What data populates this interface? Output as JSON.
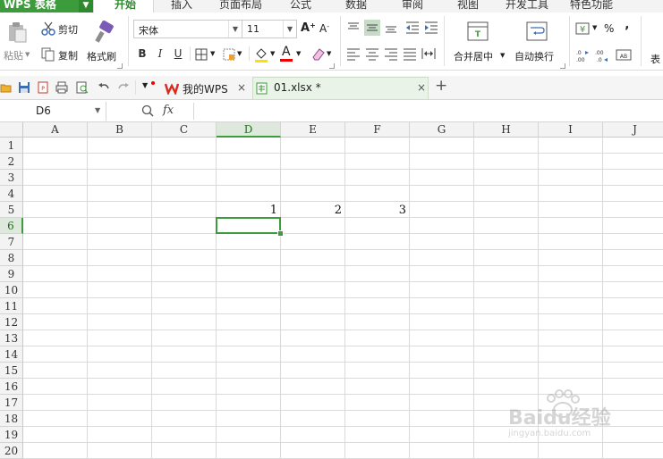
{
  "app": {
    "title": "WPS 表格"
  },
  "menu": [
    "开始",
    "插入",
    "页面布局",
    "公式",
    "数据",
    "审阅",
    "视图",
    "开发工具",
    "特色功能"
  ],
  "ribbon": {
    "paste": "粘贴",
    "cut": "剪切",
    "copy": "复制",
    "format_painter": "格式刷",
    "font_name": "宋体",
    "font_size": "11",
    "bold": "B",
    "italic": "I",
    "underline": "U",
    "merge_center": "合并居中",
    "wrap_text": "自动换行",
    "percent": "%",
    "comma": "‚",
    "table_style_partial": "表",
    "accent_color": "#3c9b3a"
  },
  "tabs": {
    "my_wps": "我的WPS",
    "file_tab": "01.xlsx *",
    "close": "×",
    "new": "+"
  },
  "formula": {
    "name_box": "D6",
    "fx": "fx",
    "value": ""
  },
  "sheet": {
    "columns": [
      "A",
      "B",
      "C",
      "D",
      "E",
      "F",
      "G",
      "H",
      "I",
      "J"
    ],
    "rows": [
      "1",
      "2",
      "3",
      "4",
      "5",
      "6",
      "7",
      "8",
      "9",
      "10",
      "11",
      "12",
      "13",
      "14",
      "15",
      "16",
      "17",
      "18",
      "19",
      "20"
    ],
    "selected_cell": "D6",
    "cells": {
      "D5": "1",
      "E5": "2",
      "F5": "3"
    }
  },
  "watermark": {
    "brand": "Baidu经验",
    "url": "jingyan.baidu.com"
  }
}
